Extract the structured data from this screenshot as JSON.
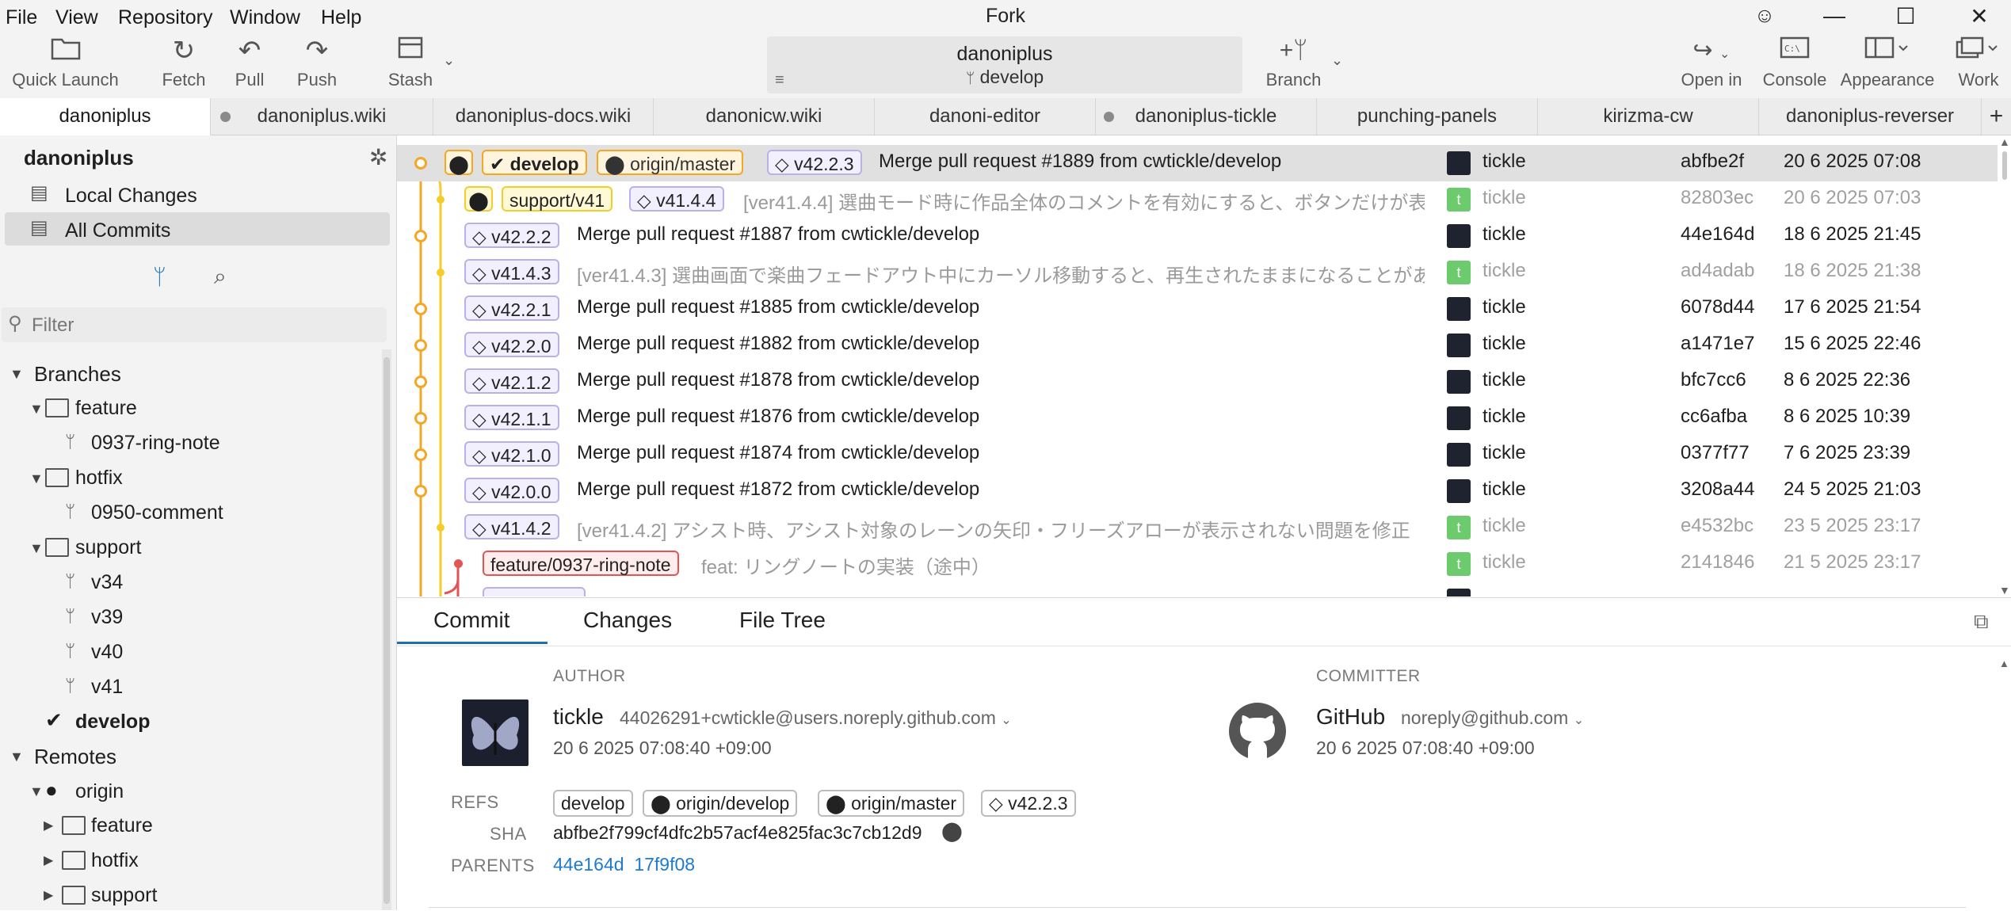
{
  "menu": [
    "File",
    "View",
    "Repository",
    "Window",
    "Help"
  ],
  "app_title": "Fork",
  "window_controls": {
    "feedback_icon": "smiley-icon",
    "minimize": "—",
    "maximize": "☐",
    "close": "✕"
  },
  "toolbar": {
    "quick_launch": "Quick Launch",
    "fetch": "Fetch",
    "pull": "Pull",
    "push": "Push",
    "stash": "Stash",
    "repo_name": "danoniplus",
    "repo_branch": "develop",
    "branch": "Branch",
    "open_in": "Open in",
    "console": "Console",
    "appearance": "Appearance",
    "work": "Work"
  },
  "tabs": [
    {
      "label": "danoniplus",
      "active": true,
      "dot": false
    },
    {
      "label": "danoniplus.wiki",
      "active": false,
      "dot": true
    },
    {
      "label": "danoniplus-docs.wiki",
      "active": false,
      "dot": false
    },
    {
      "label": "danonicw.wiki",
      "active": false,
      "dot": false
    },
    {
      "label": "danoni-editor",
      "active": false,
      "dot": false
    },
    {
      "label": "danoniplus-tickle",
      "active": false,
      "dot": true
    },
    {
      "label": "punching-panels",
      "active": false,
      "dot": false
    },
    {
      "label": "kirizma-cw",
      "active": false,
      "dot": false
    },
    {
      "label": "danoniplus-reverser",
      "active": false,
      "dot": false
    }
  ],
  "sidebar": {
    "repo": "danoniplus",
    "local_changes": "Local Changes",
    "all_commits": "All Commits",
    "filter_placeholder": "Filter",
    "branches_header": "Branches",
    "feature": "feature",
    "feature_ring": "0937-ring-note",
    "hotfix": "hotfix",
    "hotfix_comment": "0950-comment",
    "support": "support",
    "v34": "v34",
    "v39": "v39",
    "v40": "v40",
    "v41": "v41",
    "develop": "develop",
    "remotes_header": "Remotes",
    "origin": "origin",
    "r_feature": "feature",
    "r_hotfix": "hotfix",
    "r_support": "support"
  },
  "commits": {
    "r0": {
      "b_develop": "develop",
      "b_origin_master": "origin/master",
      "tag": "v42.2.3",
      "msg": "Merge pull request #1889 from cwtickle/develop",
      "author": "tickle",
      "sha": "abfbe2f",
      "date": "20 6 2025 07:08"
    },
    "r1": {
      "b_support": "support/v41",
      "tag": "v41.4.4",
      "msg_prefix": "[ver41.4.4]",
      "msg": "選曲モード時に作品全体のコメントを有効にすると、ボタンだけが表示される問...",
      "author": "tickle",
      "sha": "82803ec",
      "date": "20 6 2025 07:03"
    },
    "r2": {
      "tag": "v42.2.2",
      "msg": "Merge pull request #1887 from cwtickle/develop",
      "author": "tickle",
      "sha": "44e164d",
      "date": "18 6 2025 21:45"
    },
    "r3": {
      "tag": "v41.4.3",
      "msg_prefix": "[ver41.4.3]",
      "msg": "選曲画面で楽曲フェードアウト中にカーソル移動すると、再生されたままになることがある問題を修正",
      "author": "tickle",
      "sha": "ad4adab",
      "date": "18 6 2025 21:38"
    },
    "r4": {
      "tag": "v42.2.1",
      "msg": "Merge pull request #1885 from cwtickle/develop",
      "author": "tickle",
      "sha": "6078d44",
      "date": "17 6 2025 21:54"
    },
    "r5": {
      "tag": "v42.2.0",
      "msg": "Merge pull request #1882 from cwtickle/develop",
      "author": "tickle",
      "sha": "a1471e7",
      "date": "15 6 2025 22:46"
    },
    "r6": {
      "tag": "v42.1.2",
      "msg": "Merge pull request #1878 from cwtickle/develop",
      "author": "tickle",
      "sha": "bfc7cc6",
      "date": "8 6 2025 22:36"
    },
    "r7": {
      "tag": "v42.1.1",
      "msg": "Merge pull request #1876 from cwtickle/develop",
      "author": "tickle",
      "sha": "cc6afba",
      "date": "8 6 2025 10:39"
    },
    "r8": {
      "tag": "v42.1.0",
      "msg": "Merge pull request #1874 from cwtickle/develop",
      "author": "tickle",
      "sha": "0377f77",
      "date": "7 6 2025 23:39"
    },
    "r9": {
      "tag": "v42.0.0",
      "msg": "Merge pull request #1872 from cwtickle/develop",
      "author": "tickle",
      "sha": "3208a44",
      "date": "24 5 2025 21:03"
    },
    "r10": {
      "tag": "v41.4.2",
      "msg_prefix": "[ver41.4.2]",
      "msg": "アシスト時、アシスト対象のレーンの矢印・フリーズアローが表示されない問題を修正　他",
      "author": "tickle",
      "sha": "e4532bc",
      "date": "23 5 2025 23:17"
    },
    "r11": {
      "b_feature": "feature/0937-ring-note",
      "msg_prefix": "feat:",
      "msg": "リングノートの実装（途中）",
      "author": "tickle",
      "sha": "2141846",
      "date": "21 5 2025 23:17"
    }
  },
  "details": {
    "tab_commit": "Commit",
    "tab_changes": "Changes",
    "tab_file_tree": "File Tree",
    "author_label": "AUTHOR",
    "author_name": "tickle",
    "author_email": "44026291+cwtickle@users.noreply.github.com",
    "author_date": "20 6 2025 07:08:40 +09:00",
    "committer_label": "COMMITTER",
    "committer_name": "GitHub",
    "committer_email": "noreply@github.com",
    "committer_date": "20 6 2025 07:08:40 +09:00",
    "refs_label": "REFS",
    "ref_develop": "develop",
    "ref_origin_develop": "origin/develop",
    "ref_origin_master": "origin/master",
    "ref_tag": "v42.2.3",
    "sha_label": "SHA",
    "sha_full": "abfbe2f799cf4dfc2b57acf4e825fac3c7cb12d9",
    "parents_label": "PARENTS",
    "parent1": "44e164d",
    "parent2": "17f9f08"
  },
  "colors": {
    "branch_orange": "#f5a623",
    "support_yellow": "#f4cd2a",
    "feature_red": "#e25555",
    "tag_purple": "#b9b2e8",
    "link_blue": "#1f7bd1"
  }
}
